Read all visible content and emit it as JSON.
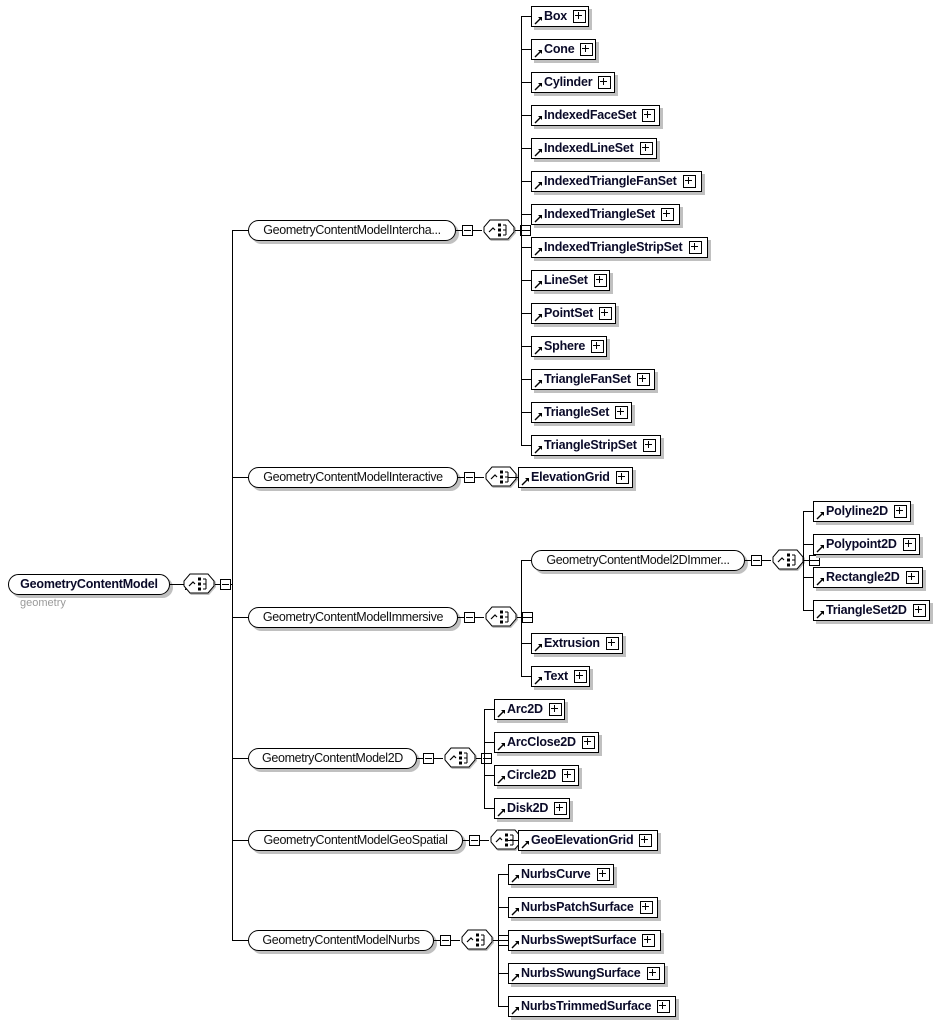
{
  "diagram": {
    "type": "xml-schema-tree",
    "title": "GeometryContentModel",
    "root": {
      "label": "GeometryContentModel",
      "caption": "geometry",
      "kind": "element"
    },
    "compositor_kind": "choice",
    "branches": [
      {
        "label": "GeometryContentModelIntercha...",
        "kind": "group",
        "children": [
          {
            "label": "Box",
            "kind": "element"
          },
          {
            "label": "Cone",
            "kind": "element"
          },
          {
            "label": "Cylinder",
            "kind": "element"
          },
          {
            "label": "IndexedFaceSet",
            "kind": "element"
          },
          {
            "label": "IndexedLineSet",
            "kind": "element"
          },
          {
            "label": "IndexedTriangleFanSet",
            "kind": "element"
          },
          {
            "label": "IndexedTriangleSet",
            "kind": "element"
          },
          {
            "label": "IndexedTriangleStripSet",
            "kind": "element"
          },
          {
            "label": "LineSet",
            "kind": "element"
          },
          {
            "label": "PointSet",
            "kind": "element"
          },
          {
            "label": "Sphere",
            "kind": "element"
          },
          {
            "label": "TriangleFanSet",
            "kind": "element"
          },
          {
            "label": "TriangleSet",
            "kind": "element"
          },
          {
            "label": "TriangleStripSet",
            "kind": "element"
          }
        ]
      },
      {
        "label": "GeometryContentModelInteractive",
        "kind": "group",
        "children": [
          {
            "label": "ElevationGrid",
            "kind": "element"
          }
        ]
      },
      {
        "label": "GeometryContentModelImmersive",
        "kind": "group",
        "children": [
          {
            "label": "GeometryContentModel2DImmer...",
            "kind": "group",
            "children": [
              {
                "label": "Polyline2D",
                "kind": "element"
              },
              {
                "label": "Polypoint2D",
                "kind": "element"
              },
              {
                "label": "Rectangle2D",
                "kind": "element"
              },
              {
                "label": "TriangleSet2D",
                "kind": "element"
              }
            ]
          },
          {
            "label": "Extrusion",
            "kind": "element"
          },
          {
            "label": "Text",
            "kind": "element"
          }
        ]
      },
      {
        "label": "GeometryContentModel2D",
        "kind": "group",
        "children": [
          {
            "label": "Arc2D",
            "kind": "element"
          },
          {
            "label": "ArcClose2D",
            "kind": "element"
          },
          {
            "label": "Circle2D",
            "kind": "element"
          },
          {
            "label": "Disk2D",
            "kind": "element"
          }
        ]
      },
      {
        "label": "GeometryContentModelGeoSpatial",
        "kind": "group",
        "children": [
          {
            "label": "GeoElevationGrid",
            "kind": "element"
          }
        ]
      },
      {
        "label": "GeometryContentModelNurbs",
        "kind": "group",
        "children": [
          {
            "label": "NurbsCurve",
            "kind": "element"
          },
          {
            "label": "NurbsPatchSurface",
            "kind": "element"
          },
          {
            "label": "NurbsSweptSurface",
            "kind": "element"
          },
          {
            "label": "NurbsSwungSurface",
            "kind": "element"
          },
          {
            "label": "NurbsTrimmedSurface",
            "kind": "element"
          }
        ]
      }
    ],
    "colors": {
      "element_text": "#0a0a28",
      "group_text": "#101010",
      "caption_text": "#9a9a9a",
      "line": "#000000",
      "shadow": "#c0c0c0",
      "background": "#ffffff"
    },
    "icons": {
      "expander": "plus-box-icon",
      "collapser": "minus-box-icon",
      "compositor": "choice-compositor-icon",
      "reference": "element-reference-arrow-icon"
    }
  }
}
